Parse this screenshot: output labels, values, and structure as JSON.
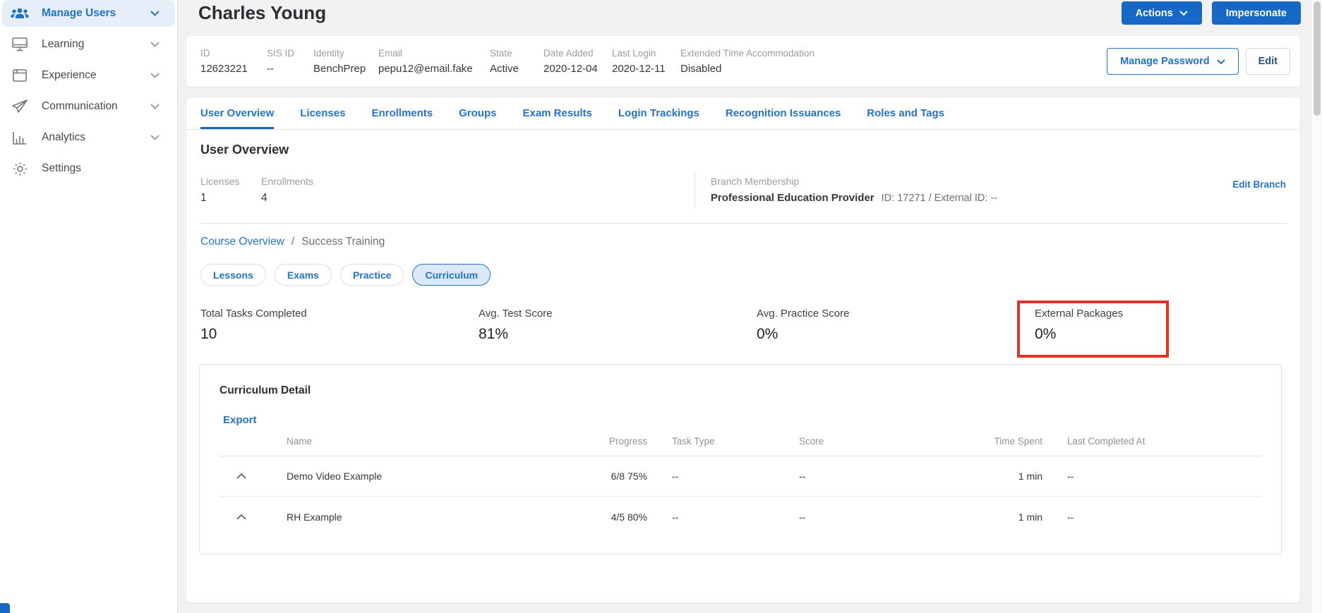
{
  "page": {
    "title": "Charles Young"
  },
  "title_actions": {
    "actions": "Actions",
    "impersonate": "Impersonate"
  },
  "sidebar": {
    "items": [
      {
        "label": "Manage Users"
      },
      {
        "label": "Learning"
      },
      {
        "label": "Experience"
      },
      {
        "label": "Communication"
      },
      {
        "label": "Analytics"
      },
      {
        "label": "Settings"
      }
    ]
  },
  "user_info": {
    "fields": [
      {
        "label": "ID",
        "value": "12623221"
      },
      {
        "label": "SIS ID",
        "value": "--"
      },
      {
        "label": "Identity",
        "value": "BenchPrep"
      },
      {
        "label": "Email",
        "value": "pepu12@email.fake"
      },
      {
        "label": "State",
        "value": "Active"
      },
      {
        "label": "Date Added",
        "value": "2020-12-04"
      },
      {
        "label": "Last Login",
        "value": "2020-12-11"
      },
      {
        "label": "Extended Time Accommodation",
        "value": "Disabled"
      }
    ],
    "manage_password": "Manage Password",
    "edit": "Edit"
  },
  "tabs": [
    {
      "label": "User Overview"
    },
    {
      "label": "Licenses"
    },
    {
      "label": "Enrollments"
    },
    {
      "label": "Groups"
    },
    {
      "label": "Exam Results"
    },
    {
      "label": "Login Trackings"
    },
    {
      "label": "Recognition Issuances"
    },
    {
      "label": "Roles and Tags"
    }
  ],
  "overview": {
    "heading": "User Overview",
    "licenses_label": "Licenses",
    "licenses_value": "1",
    "enrollments_label": "Enrollments",
    "enrollments_value": "4",
    "branch": {
      "label": "Branch Membership",
      "name": "Professional Education Provider",
      "details": "ID: 17271 / External ID: --",
      "edit_link": "Edit Branch"
    }
  },
  "breadcrumb": {
    "parent": "Course Overview",
    "separator": "/",
    "current": "Success Training"
  },
  "pills": [
    {
      "label": "Lessons"
    },
    {
      "label": "Exams"
    },
    {
      "label": "Practice"
    },
    {
      "label": "Curriculum"
    }
  ],
  "stats": [
    {
      "label": "Total Tasks Completed",
      "value": "10"
    },
    {
      "label": "Avg. Test Score",
      "value": "81%"
    },
    {
      "label": "Avg. Practice Score",
      "value": "0%"
    },
    {
      "label": "External Packages",
      "value": "0%"
    }
  ],
  "curriculum": {
    "title": "Curriculum Detail",
    "export_label": "Export",
    "columns": [
      "Name",
      "Progress",
      "Task Type",
      "Score",
      "Time Spent",
      "Last Completed At"
    ],
    "rows": [
      {
        "name": "Demo Video Example",
        "progress": "6/8 75%",
        "task_type": "--",
        "score": "--",
        "time_spent": "1 min",
        "last_completed": "--"
      },
      {
        "name": "RH Example",
        "progress": "4/5 80%",
        "task_type": "--",
        "score": "--",
        "time_spent": "1 min",
        "last_completed": "--"
      }
    ]
  },
  "colors": {
    "primary": "#1568c6",
    "link": "#2373cc",
    "annotation": "#e23227",
    "active_pill_bg": "#dce9f8"
  }
}
